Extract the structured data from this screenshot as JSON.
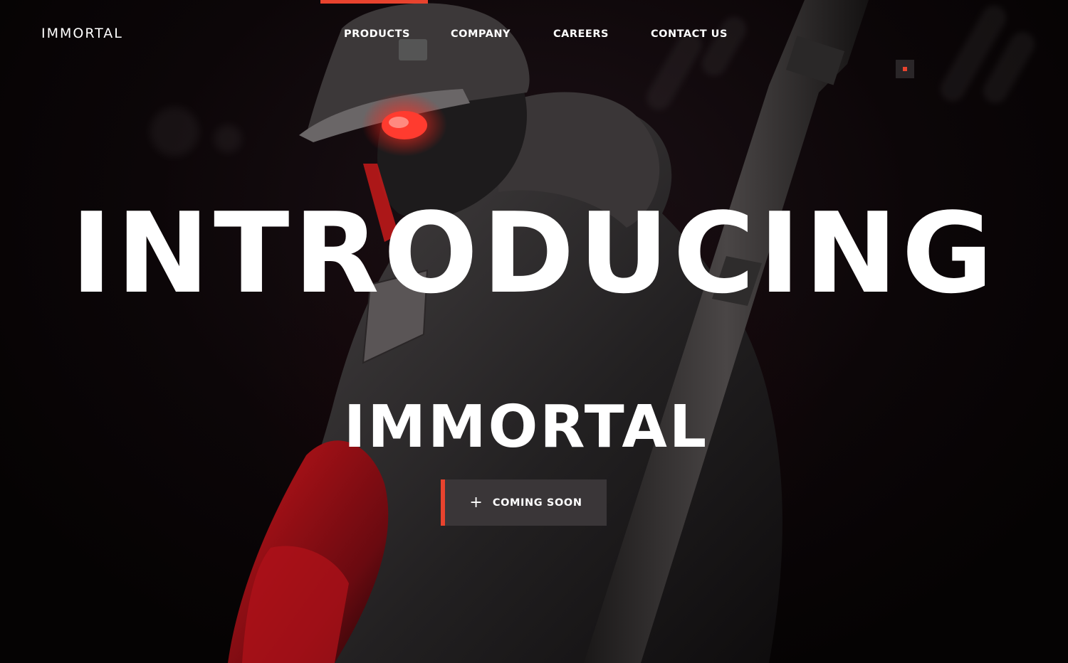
{
  "brand": {
    "logo_text": "IMMORTAL"
  },
  "nav": {
    "items": [
      {
        "label": "PRODUCTS",
        "active": true
      },
      {
        "label": "COMPANY",
        "active": false
      },
      {
        "label": "CAREERS",
        "active": false
      },
      {
        "label": "CONTACT US",
        "active": false
      }
    ]
  },
  "hero": {
    "headline": "INTRODUCING",
    "title": "IMMORTAL",
    "cta_icon": "plus-icon",
    "cta_label": "COMING SOON",
    "image_subject": "hero-soldier-image"
  },
  "menu_toggle": {
    "icon": "menu-square-icon"
  },
  "colors": {
    "accent": "#e8432e",
    "background": "#0a0507",
    "text": "#ffffff",
    "button_bg": "#3a3638"
  }
}
